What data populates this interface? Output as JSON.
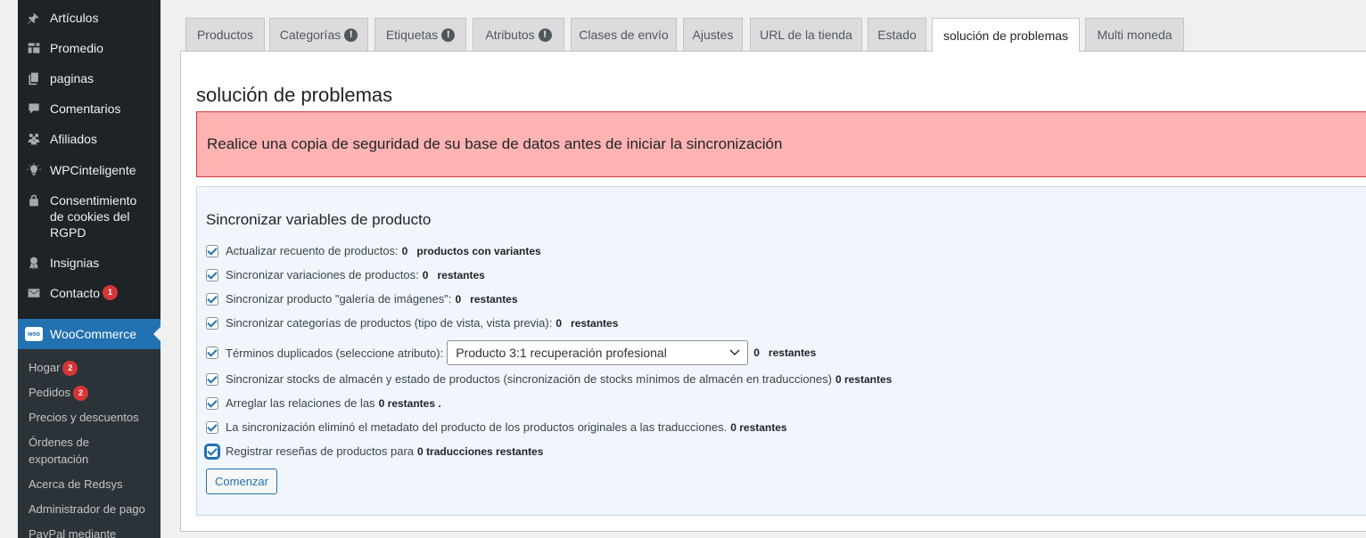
{
  "sidebar": {
    "items": [
      {
        "label": "Artículos",
        "icon": "pin-icon"
      },
      {
        "label": "Promedio",
        "icon": "media-icon"
      },
      {
        "label": "paginas",
        "icon": "pages-icon"
      },
      {
        "label": "Comentarios",
        "icon": "comments-icon"
      },
      {
        "label": "Afiliados",
        "icon": "affiliates-icon"
      },
      {
        "label": "WPCinteligente",
        "icon": "bulb-icon"
      },
      {
        "label": "Consentimiento de cookies del RGPD",
        "icon": "lock-icon"
      },
      {
        "label": "Insignias",
        "icon": "award-icon"
      },
      {
        "label": "Contacto",
        "icon": "mail-icon",
        "badge": "1"
      }
    ],
    "woocommerce": {
      "label": "WooCommerce",
      "logo_text": "woo"
    },
    "submenu": [
      {
        "label": "Hogar",
        "badge": "2"
      },
      {
        "label": "Pedidos",
        "badge": "2"
      },
      {
        "label": "Precios y descuentos"
      },
      {
        "label": "Órdenes de exportación"
      },
      {
        "label": "Acerca de Redsys"
      },
      {
        "label": "Administrador de pago"
      },
      {
        "label": "PayPal mediante"
      }
    ]
  },
  "tabs": [
    {
      "label": "Productos"
    },
    {
      "label": "Categorías",
      "alert": "!"
    },
    {
      "label": "Etiquetas",
      "alert": "!"
    },
    {
      "label": "Atributos",
      "alert": "!"
    },
    {
      "label": "Clases de envío"
    },
    {
      "label": "Ajustes"
    },
    {
      "label": "URL de la tienda"
    },
    {
      "label": "Estado"
    },
    {
      "label": "solución de problemas",
      "active": true
    },
    {
      "label": "Multi moneda"
    }
  ],
  "main": {
    "title": "solución de problemas",
    "warning": "Realice una copia de seguridad de su base de datos antes de iniciar la sincronización",
    "section_title": "Sincronizar variables de producto",
    "options": [
      {
        "label": "Actualizar recuento de productos:",
        "count": "0",
        "suffix": "productos con variantes"
      },
      {
        "label": "Sincronizar variaciones de productos:",
        "count": "0",
        "suffix": "restantes"
      },
      {
        "label": "Sincronizar producto \"galería de imágenes\":",
        "count": "0",
        "suffix": "restantes"
      },
      {
        "label": "Sincronizar categorías de productos (tipo de vista, vista previa):",
        "count": "0",
        "suffix": "restantes"
      },
      {
        "label": "Términos duplicados (seleccione atributo):",
        "select_value": "Producto 3:1 recuperación profesional",
        "count": "0",
        "suffix": "restantes"
      },
      {
        "label": "Sincronizar stocks de almacén y estado de productos (sincronización de stocks mínimos de almacén en traducciones)",
        "count": "0 restantes"
      },
      {
        "label": "Arreglar las relaciones de las",
        "count": "0 restantes ."
      },
      {
        "label": "La sincronización eliminó el metadato del producto de los productos originales a las traducciones.",
        "count": "0 restantes"
      },
      {
        "label": "Registrar reseñas de productos para",
        "count": "0 traducciones restantes"
      }
    ],
    "start_button": "Comenzar"
  },
  "colors": {
    "sidebar_bg": "#1d2327",
    "accent": "#2271b1",
    "warning_bg": "#ffb3b3",
    "warning_border": "#d63638",
    "badge": "#d63638",
    "info_bg": "#f0f6fc"
  }
}
